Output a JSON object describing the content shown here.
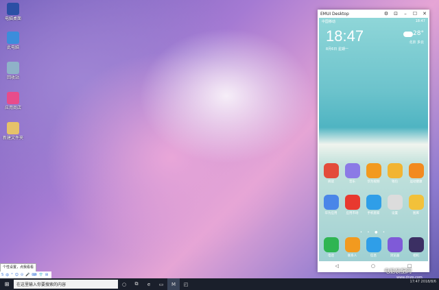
{
  "desktop": {
    "icons": [
      {
        "name": "emui-desktop-icon",
        "label": "电脑桌面",
        "color": "#2b4fa5"
      },
      {
        "name": "this-pc-icon",
        "label": "此电脑",
        "color": "#3c8ddb"
      },
      {
        "name": "recycle-bin-icon",
        "label": "回收站",
        "color": "#8fb2c8"
      },
      {
        "name": "app-store-icon",
        "label": "应用商店",
        "color": "#e84c8b"
      },
      {
        "name": "folder-icon",
        "label": "新建文件夹",
        "color": "#e5c26a"
      }
    ]
  },
  "window": {
    "title": "EMUI Desktop",
    "settings_glyph": "⚙",
    "pin_glyph": "⊡",
    "minimize_glyph": "–",
    "maximize_glyph": "☐",
    "close_glyph": "✕"
  },
  "phone": {
    "status_left": "中国移动",
    "status_right": "18:47",
    "clock": "18:47",
    "date": "8月6日 星期一",
    "weather_temp": "28°",
    "weather_sub": "北京 多云",
    "rows": [
      [
        {
          "label": "阅读",
          "color": "#e34b3b"
        },
        {
          "label": "音乐",
          "color": "#8b7ae6"
        },
        {
          "label": "华为视频",
          "color": "#f29a1f"
        },
        {
          "label": "钱包",
          "color": "#f2b431"
        },
        {
          "label": "运动健康",
          "color": "#f28a1f"
        }
      ],
      [
        {
          "label": "华为应用",
          "color": "#4a86e8"
        },
        {
          "label": "应用市场",
          "color": "#e8392f"
        },
        {
          "label": "手机管家",
          "color": "#2f9ee8"
        },
        {
          "label": "设置",
          "color": "#dcdcdc"
        },
        {
          "label": "图库",
          "color": "#f2c13a"
        }
      ],
      [
        {
          "label": "电话",
          "color": "#2fb552"
        },
        {
          "label": "联系人",
          "color": "#f29a1f"
        },
        {
          "label": "信息",
          "color": "#2f9ee8"
        },
        {
          "label": "浏览器",
          "color": "#7f5ad8"
        },
        {
          "label": "相机",
          "color": "#3b2f63"
        }
      ]
    ],
    "page_dots": "• • ● •",
    "nav": {
      "back": "◁",
      "home": "○",
      "recent": "□"
    }
  },
  "ime": {
    "tooltip": "个性设置，点我看看",
    "items": [
      "S",
      "中",
      "°",
      "☺",
      "⊙",
      "🎤",
      "⌨",
      "👕",
      "⊞"
    ]
  },
  "taskbar": {
    "start_glyph": "⊞",
    "search_placeholder": "在这里输入你要搜索的内容",
    "icons": [
      {
        "name": "cortana-icon",
        "glyph": "○"
      },
      {
        "name": "task-view-icon",
        "glyph": "⧉"
      },
      {
        "name": "edge-icon",
        "glyph": "e"
      },
      {
        "name": "file-explorer-icon",
        "glyph": "▭"
      },
      {
        "name": "emui-icon",
        "glyph": "M"
      },
      {
        "name": "store-icon",
        "glyph": "◰"
      }
    ],
    "tray_text": "17:47\n2018/8/6"
  },
  "watermark": {
    "text": "电脑装配网",
    "url": "www.dnzp.com"
  }
}
